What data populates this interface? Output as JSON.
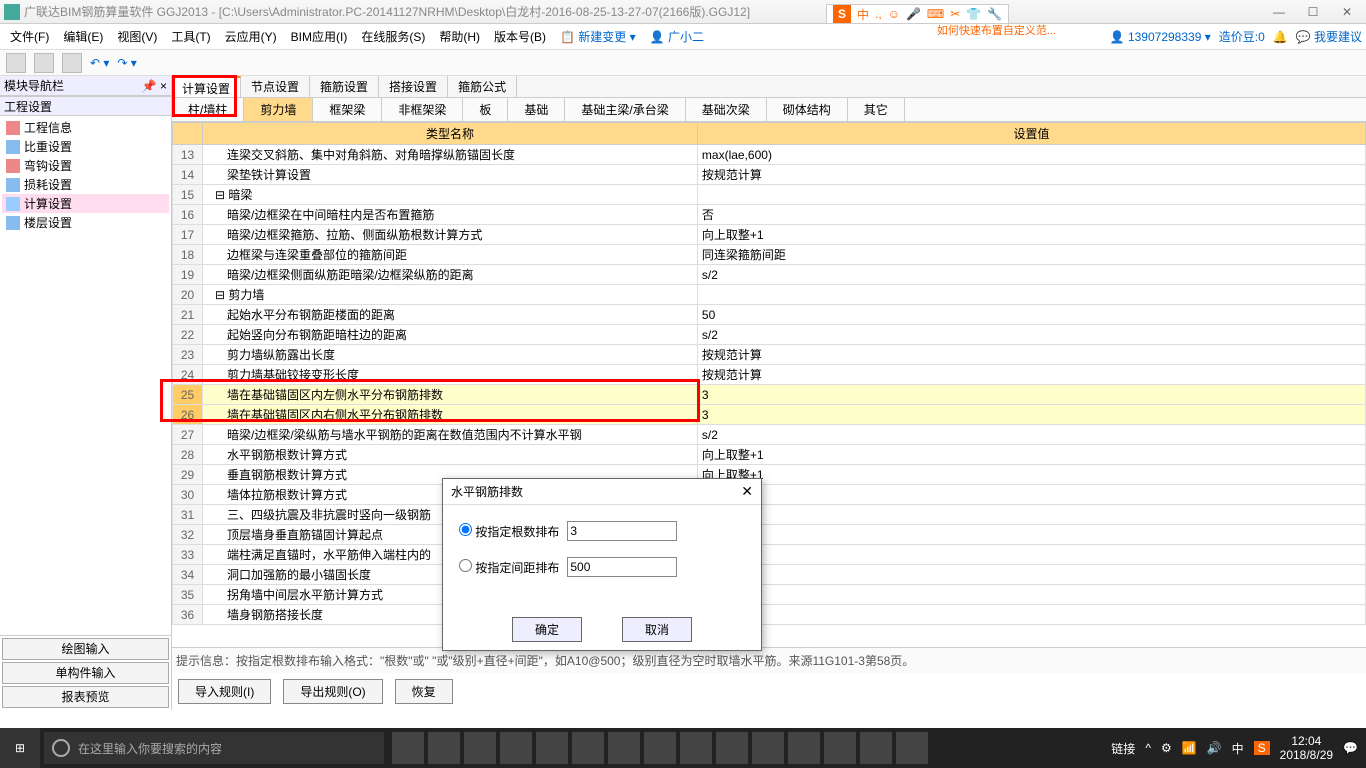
{
  "title": "广联达BIM钢筋算量软件 GGJ2013 - [C:\\Users\\Administrator.PC-20141127NRHM\\Desktop\\白龙村-2016-08-25-13-27-07(2166版).GGJ12]",
  "menu": [
    "文件(F)",
    "编辑(E)",
    "视图(V)",
    "工具(T)",
    "云应用(Y)",
    "BIM应用(I)",
    "在线服务(S)",
    "帮助(H)",
    "版本号(B)"
  ],
  "menuExtra": {
    "newChange": "新建变更",
    "user": "广小二"
  },
  "rightInfo": {
    "phone": "13907298339",
    "coin": "造价豆:0",
    "suggest": "我要建议"
  },
  "ad": "如何快速布置自定义范...",
  "nav": {
    "title": "模块导航栏"
  },
  "treeHeader": "工程设置",
  "tree": [
    {
      "label": "工程信息"
    },
    {
      "label": "比重设置"
    },
    {
      "label": "弯钩设置"
    },
    {
      "label": "损耗设置"
    },
    {
      "label": "计算设置",
      "sel": true
    },
    {
      "label": "楼层设置"
    }
  ],
  "leftBtns": [
    "绘图输入",
    "单构件输入",
    "报表预览"
  ],
  "tabs1": [
    "计算设置",
    "节点设置",
    "箍筋设置",
    "搭接设置",
    "箍筋公式"
  ],
  "tabs1Active": 0,
  "tabs2": [
    "柱/墙柱",
    "剪力墙",
    "框架梁",
    "非框架梁",
    "板",
    "基础",
    "基础主梁/承台梁",
    "基础次梁",
    "砌体结构",
    "其它"
  ],
  "tabs2Active": 1,
  "colHeaders": {
    "type": "类型名称",
    "value": "设置值"
  },
  "rows": [
    {
      "n": 13,
      "name": "连梁交叉斜筋、集中对角斜筋、对角暗撑纵筋锚固长度",
      "val": "max(lae,600)",
      "i": 1
    },
    {
      "n": 14,
      "name": "梁垫铁计算设置",
      "val": "按规范计算",
      "i": 1
    },
    {
      "n": 15,
      "name": "暗梁",
      "val": "",
      "i": 0,
      "grp": true
    },
    {
      "n": 16,
      "name": "暗梁/边框梁在中间暗柱内是否布置箍筋",
      "val": "否",
      "i": 1
    },
    {
      "n": 17,
      "name": "暗梁/边框梁箍筋、拉筋、侧面纵筋根数计算方式",
      "val": "向上取整+1",
      "i": 1
    },
    {
      "n": 18,
      "name": "边框梁与连梁重叠部位的箍筋间距",
      "val": "同连梁箍筋间距",
      "i": 1
    },
    {
      "n": 19,
      "name": "暗梁/边框梁侧面纵筋距暗梁/边框梁纵筋的距离",
      "val": "s/2",
      "i": 1
    },
    {
      "n": 20,
      "name": "剪力墙",
      "val": "",
      "i": 0,
      "grp": true
    },
    {
      "n": 21,
      "name": "起始水平分布钢筋距楼面的距离",
      "val": "50",
      "i": 1
    },
    {
      "n": 22,
      "name": "起始竖向分布钢筋距暗柱边的距离",
      "val": "s/2",
      "i": 1
    },
    {
      "n": 23,
      "name": "剪力墙纵筋露出长度",
      "val": "按规范计算",
      "i": 1
    },
    {
      "n": 24,
      "name": "剪力墙基础铰接变形长度",
      "val": "按规范计算",
      "i": 1
    },
    {
      "n": 25,
      "name": "墙在基础锚固区内左侧水平分布钢筋排数",
      "val": "3",
      "i": 1,
      "hl": true
    },
    {
      "n": 26,
      "name": "墙在基础锚固区内右侧水平分布钢筋排数",
      "val": "3",
      "i": 1,
      "hl": true
    },
    {
      "n": 27,
      "name": "暗梁/边框梁/梁纵筋与墙水平钢筋的距离在数值范围内不计算水平钢",
      "val": "s/2",
      "i": 1
    },
    {
      "n": 28,
      "name": "水平钢筋根数计算方式",
      "val": "向上取整+1",
      "i": 1
    },
    {
      "n": 29,
      "name": "垂直钢筋根数计算方式",
      "val": "向上取整+1",
      "i": 1
    },
    {
      "n": 30,
      "name": "墙体拉筋根数计算方式",
      "val": "",
      "i": 1
    },
    {
      "n": 31,
      "name": "三、四级抗震及非抗震时竖向一级钢筋",
      "val": "",
      "i": 1
    },
    {
      "n": 32,
      "name": "顶层墙身垂直筋锚固计算起点",
      "val": "",
      "i": 1
    },
    {
      "n": 33,
      "name": "端柱满足直锚时，水平筋伸入端柱内的",
      "val": "",
      "i": 1
    },
    {
      "n": 34,
      "name": "洞口加强筋的最小锚固长度",
      "val": "",
      "i": 1
    },
    {
      "n": 35,
      "name": "拐角墙中间层水平筋计算方式",
      "val": "",
      "i": 1
    },
    {
      "n": 36,
      "name": "墙身钢筋搭接长度",
      "val": "",
      "i": 1
    }
  ],
  "hint": "提示信息：按指定根数排布输入格式：\"根数\"或\"                                                                                           \"或\"级别+直径+间距\"，如A10@500；级别直径为空时取墙水平筋。来源11G101-3第58页。",
  "ruleBtns": [
    "导入规则(I)",
    "导出规则(O)",
    "恢复"
  ],
  "dialog": {
    "title": "水平钢筋排数",
    "opt1": "按指定根数排布",
    "val1": "3",
    "opt2": "按指定间距排布",
    "val2": "500",
    "ok": "确定",
    "cancel": "取消"
  },
  "ime": {
    "s": "S",
    "items": [
      "中",
      ".,",
      "☺",
      "🎤",
      "⌨",
      "✂",
      "👕",
      "🔧"
    ]
  },
  "taskbar": {
    "search": "在这里输入你要搜索的内容",
    "link": "链接",
    "time": "12:04",
    "date": "2018/8/29",
    "lang": "中"
  }
}
